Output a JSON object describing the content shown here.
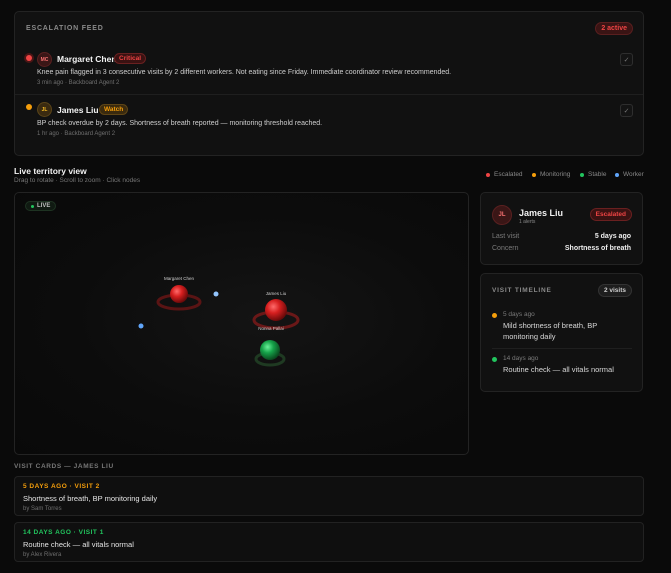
{
  "feed": {
    "title": "ESCALATION FEED",
    "active_badge": "2 active",
    "items": [
      {
        "initials": "MC",
        "name": "Margaret Chen",
        "badge": "Critical",
        "text": "Knee pain flagged in 3 consecutive visits by 2 different workers. Not eating since Friday. Immediate coordinator review recommended.",
        "meta": "3 min ago · Backboard Agent 2",
        "check": "✓"
      },
      {
        "initials": "JL",
        "name": "James Liu",
        "badge": "Watch",
        "text": "BP check overdue by 2 days. Shortness of breath reported — monitoring threshold reached.",
        "meta": "1 hr ago · Backboard Agent 2",
        "check": "✓"
      }
    ]
  },
  "territory": {
    "title": "Live territory view",
    "subtitle": "Drag to rotate · Scroll to zoom · Click nodes",
    "legend": [
      {
        "label": "Escalated",
        "color": "#ef4444"
      },
      {
        "label": "Monitoring",
        "color": "#f59e0b"
      },
      {
        "label": "Stable",
        "color": "#22c55e"
      },
      {
        "label": "Worker",
        "color": "#60a5fa"
      }
    ],
    "live_label": "LIVE",
    "nodes": [
      {
        "label": "Margaret Chen",
        "status": "Escalated"
      },
      {
        "label": "James Liu",
        "status": "Escalated"
      },
      {
        "label": "Nonna Pallai",
        "status": "Stable"
      }
    ]
  },
  "detail": {
    "initials": "JL",
    "name": "James Liu",
    "sub": "1 alerts",
    "status": "Escalated",
    "rows": [
      {
        "label": "Last visit",
        "value": "5 days ago"
      },
      {
        "label": "Concern",
        "value": "Shortness of breath"
      }
    ]
  },
  "timeline": {
    "title": "VISIT TIMELINE",
    "count": "2 visits",
    "entries": [
      {
        "date": "5 days ago",
        "text": "Mild shortness of breath, BP monitoring daily",
        "color": "#f59e0b"
      },
      {
        "date": "14 days ago",
        "text": "Routine check — all vitals normal",
        "color": "#22c55e"
      }
    ]
  },
  "visit_cards": {
    "heading": "VISIT CARDS — JAMES LIU",
    "cards": [
      {
        "date": "5 DAYS AGO · VISIT 2",
        "text": "Shortness of breath, BP monitoring daily",
        "by": "by Sam Torres",
        "color": "#f59e0b"
      },
      {
        "date": "14 DAYS AGO · VISIT 1",
        "text": "Routine check — all vitals normal",
        "by": "by Alex Rivera",
        "color": "#22c55e"
      }
    ]
  }
}
